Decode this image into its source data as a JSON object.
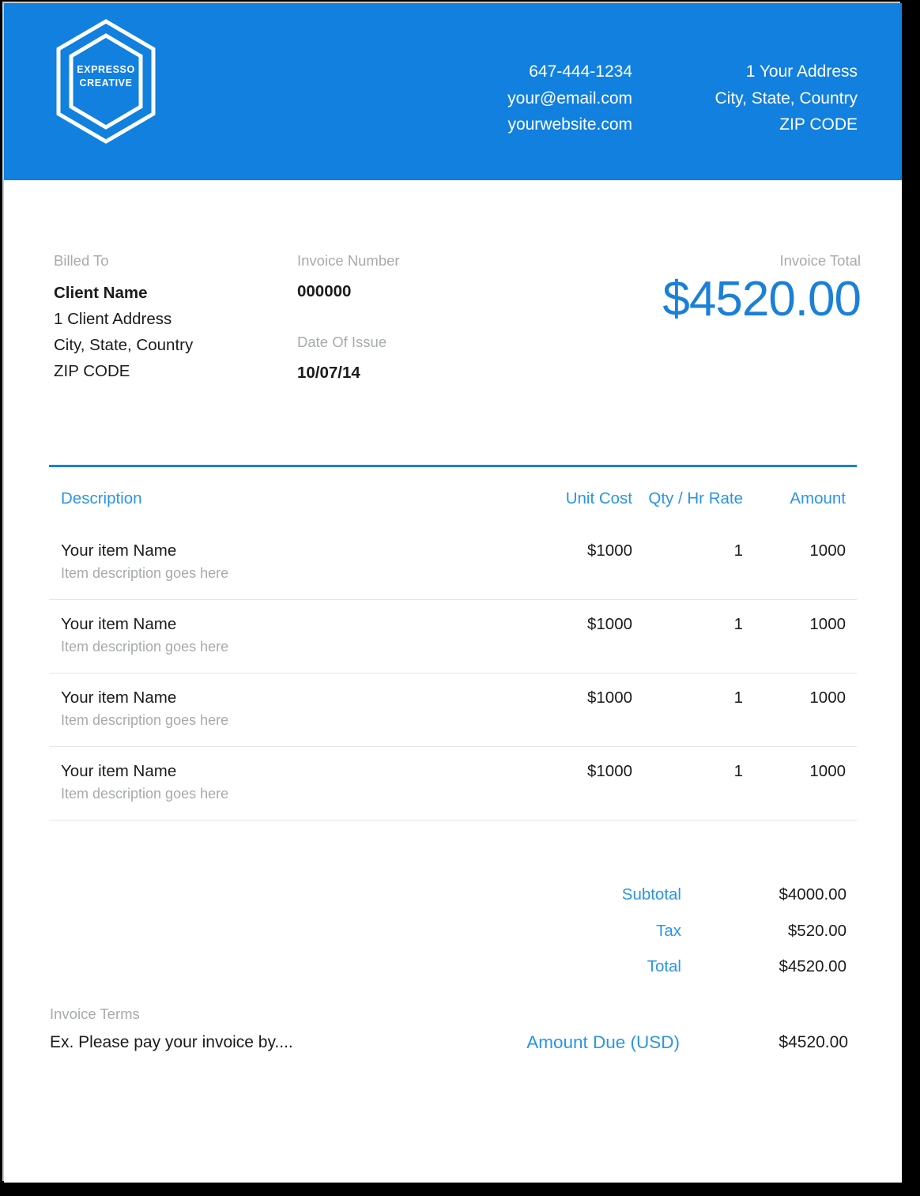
{
  "brand": {
    "accent_blue": "#1180df",
    "accent_text_blue": "#2a95e6",
    "total_blue": "#1a80d8",
    "muted_gray": "#a7aaad",
    "logo_line_1": "EXPRESSO",
    "logo_line_2": "CREATIVE"
  },
  "header": {
    "phone": "647-444-1234",
    "email": "your@email.com",
    "website": "yourwebsite.com",
    "address_line_1": "1 Your Address",
    "address_line_2": "City, State, Country",
    "address_line_3": "ZIP CODE"
  },
  "billed_to": {
    "label": "Billed To",
    "client_name": "Client Name",
    "address_line_1": "1 Client Address",
    "address_line_2": "City, State, Country",
    "address_line_3": "ZIP CODE"
  },
  "invoice_meta": {
    "number_label": "Invoice Number",
    "number_value": "000000",
    "date_label": "Date Of Issue",
    "date_value": "10/07/14"
  },
  "invoice_total": {
    "label": "Invoice Total",
    "amount": "$4520.00"
  },
  "table": {
    "headers": {
      "description": "Description",
      "unit_cost": "Unit Cost",
      "qty": "Qty / Hr Rate",
      "amount": "Amount"
    },
    "rows": [
      {
        "name": "Your item Name",
        "description": "Item description goes here",
        "unit_cost": "$1000",
        "qty": "1",
        "amount": "1000"
      },
      {
        "name": "Your item Name",
        "description": "Item description goes here",
        "unit_cost": "$1000",
        "qty": "1",
        "amount": "1000"
      },
      {
        "name": "Your item Name",
        "description": "Item description goes here",
        "unit_cost": "$1000",
        "qty": "1",
        "amount": "1000"
      },
      {
        "name": "Your item Name",
        "description": "Item description goes here",
        "unit_cost": "$1000",
        "qty": "1",
        "amount": "1000"
      }
    ]
  },
  "totals": [
    {
      "label": "Subtotal",
      "value": "$4000.00"
    },
    {
      "label": "Tax",
      "value": "$520.00"
    },
    {
      "label": "Total",
      "value": "$4520.00"
    }
  ],
  "terms": {
    "label": "Invoice Terms",
    "text": "Ex. Please pay your invoice by....",
    "amount_due_label": "Amount Due (USD)",
    "amount_due_value": "$4520.00"
  }
}
